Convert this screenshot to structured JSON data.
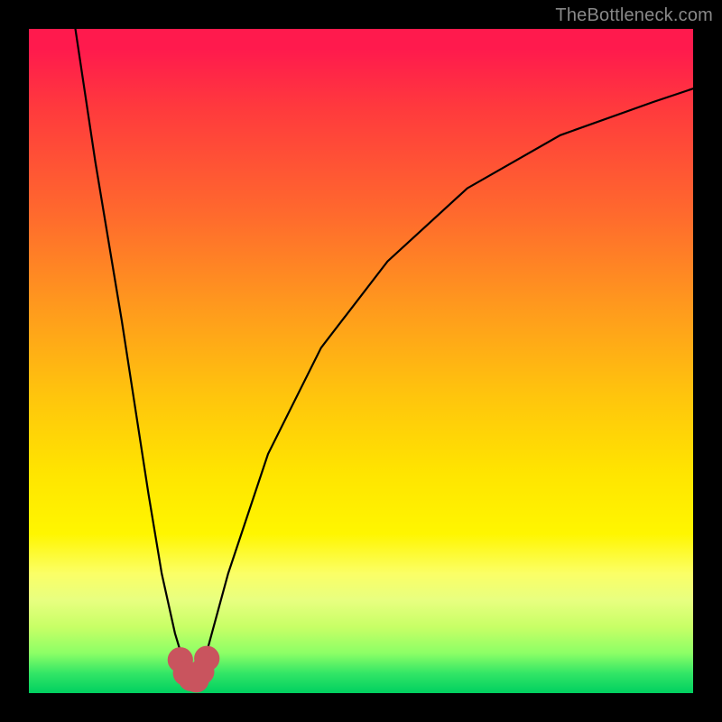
{
  "watermark": "TheBottleneck.com",
  "colors": {
    "background_outer": "#000000",
    "gradient_top": "#ff1a4d",
    "gradient_mid": "#ffe500",
    "gradient_bottom": "#00d060",
    "curve_stroke": "#000000",
    "marker_fill": "#c9545e"
  },
  "chart_data": {
    "type": "line",
    "title": "",
    "xlabel": "",
    "ylabel": "",
    "xlim": [
      0,
      100
    ],
    "ylim": [
      0,
      100
    ],
    "grid": false,
    "legend": false,
    "series": [
      {
        "name": "curve",
        "x": [
          7,
          10,
          14,
          18,
          20,
          22,
          23.5,
          24.5,
          25.5,
          27,
          30,
          36,
          44,
          54,
          66,
          80,
          94,
          100
        ],
        "y": [
          100,
          80,
          56,
          30,
          18,
          9,
          4,
          2,
          3,
          7,
          18,
          36,
          52,
          65,
          76,
          84,
          89,
          91
        ]
      }
    ],
    "markers": [
      {
        "x": 22.8,
        "y": 5.0,
        "r": 1.2
      },
      {
        "x": 23.6,
        "y": 3.0,
        "r": 1.2
      },
      {
        "x": 24.4,
        "y": 2.2,
        "r": 1.2
      },
      {
        "x": 25.2,
        "y": 2.0,
        "r": 1.2
      },
      {
        "x": 26.0,
        "y": 3.2,
        "r": 1.2
      },
      {
        "x": 26.8,
        "y": 5.2,
        "r": 1.2
      }
    ],
    "notes": "y = 0 at plot bottom, 100 at plot top; x = 0 at left, 100 at right. Values estimated from pixels."
  }
}
